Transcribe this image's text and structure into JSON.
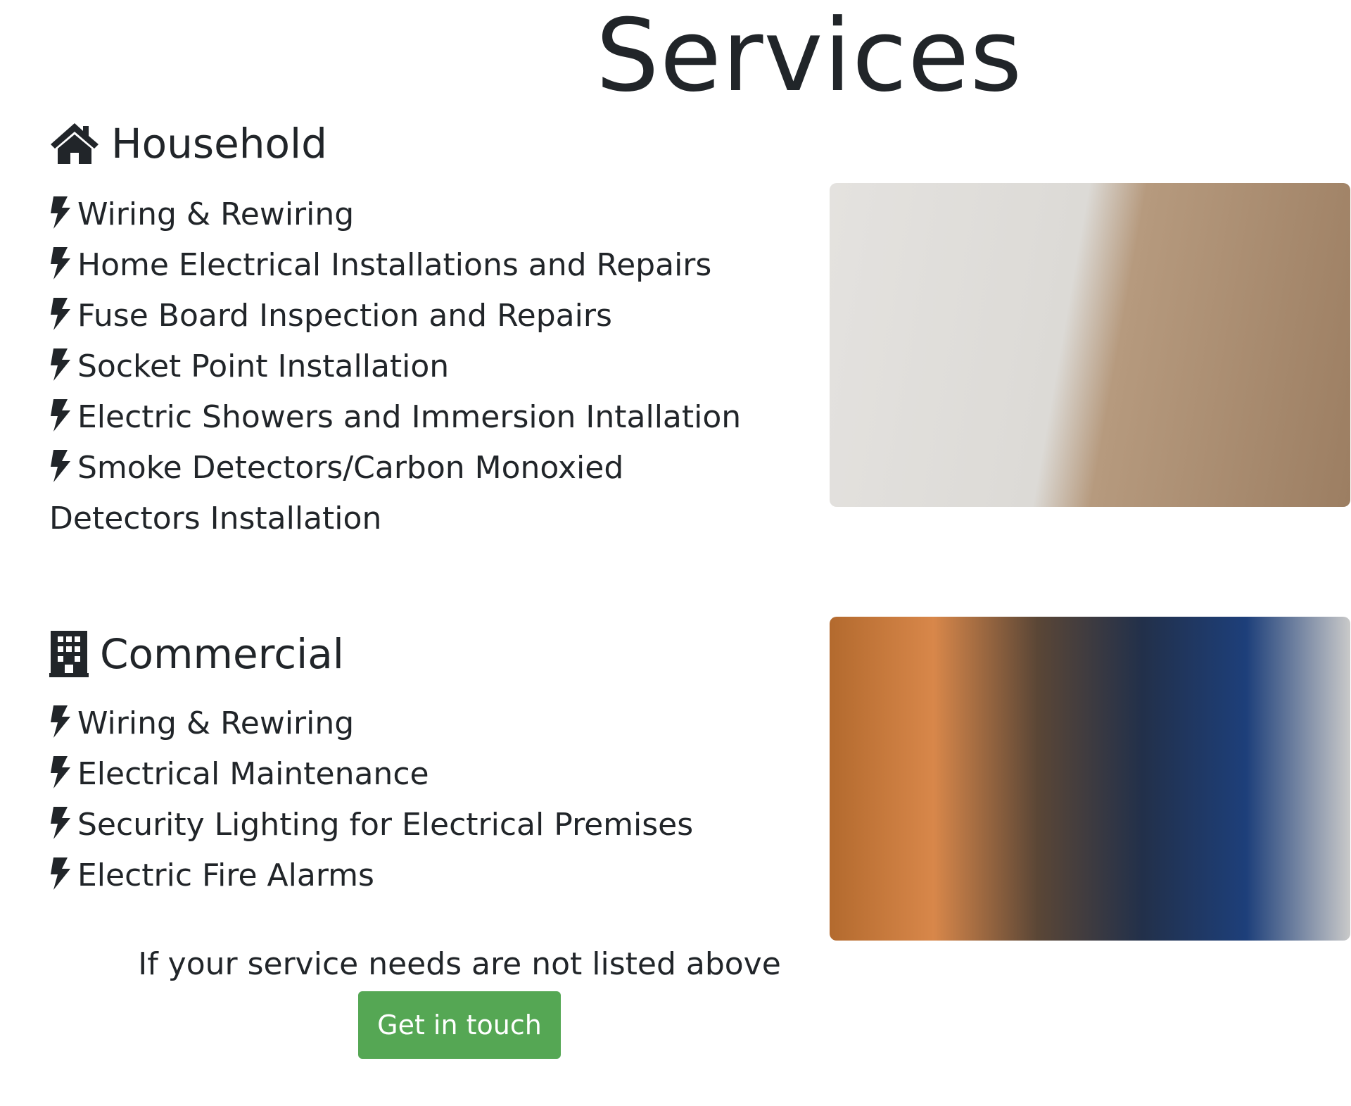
{
  "page_title": "Services",
  "household": {
    "title": "Household",
    "icon": "home-icon",
    "items": [
      "Wiring & Rewiring",
      "Home Electrical Installations and Repairs",
      "Fuse Board Inspection and Repairs",
      "Socket Point Installation",
      "Electric Showers and Immersion Intallation",
      "Smoke Detectors/Carbon Monoxied Detectors Installation"
    ]
  },
  "commercial": {
    "title": "Commercial",
    "icon": "building-icon",
    "items": [
      "Wiring & Rewiring",
      "Electrical Maintenance",
      "Security Lighting for Electrical Premises",
      "Electric Fire Alarms"
    ]
  },
  "note": "If your service needs are not listed above",
  "cta_label": "Get in touch",
  "colors": {
    "text": "#212529",
    "button": "#55a754"
  }
}
